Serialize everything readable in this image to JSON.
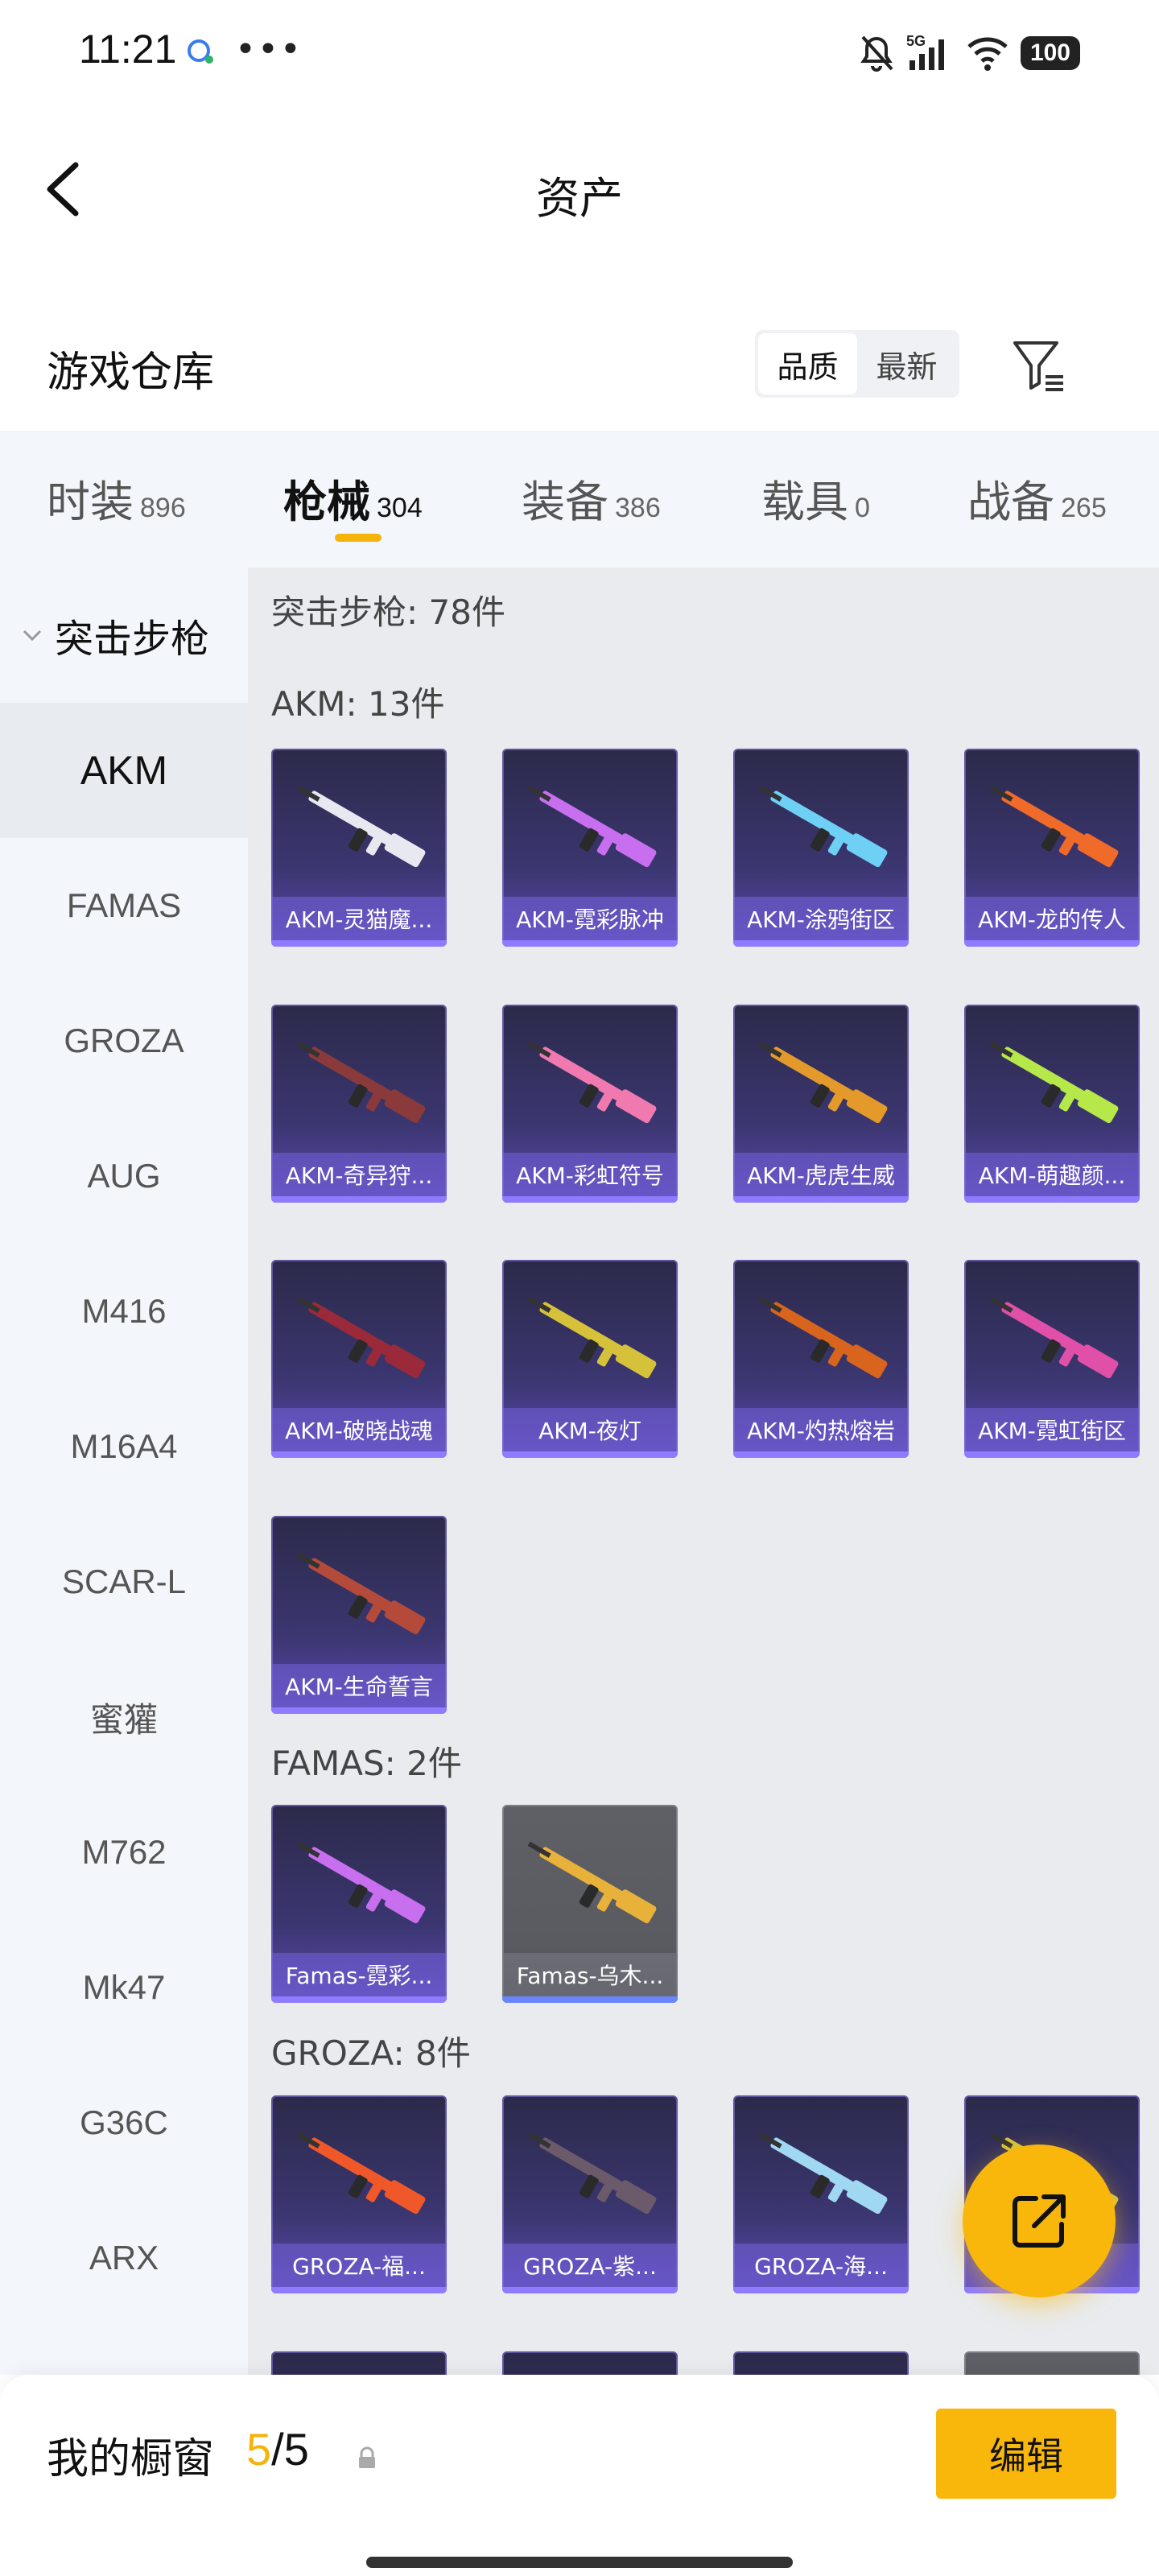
{
  "status_bar": {
    "time": "11:21",
    "dots": "•••",
    "network": "5G",
    "battery": "100"
  },
  "nav": {
    "title": "资产"
  },
  "header": {
    "title": "游戏仓库",
    "sort_options": [
      "品质",
      "最新"
    ],
    "active_sort": "品质"
  },
  "tabs": [
    {
      "label": "时装",
      "count": "896"
    },
    {
      "label": "枪械",
      "count": "304"
    },
    {
      "label": "装备",
      "count": "386"
    },
    {
      "label": "载具",
      "count": "0"
    },
    {
      "label": "战备",
      "count": "265"
    }
  ],
  "active_tab": "枪械",
  "sidebar": {
    "category": "突击步枪",
    "items": [
      "AKM",
      "FAMAS",
      "GROZA",
      "AUG",
      "M416",
      "M16A4",
      "SCAR-L",
      "蜜獾",
      "M762",
      "Mk47",
      "G36C",
      "ARX"
    ],
    "active": "AKM"
  },
  "content": {
    "summary": "突击步枪: 78件",
    "groups": [
      {
        "title": "AKM: 13件",
        "items": [
          "AKM-灵猫魔...",
          "AKM-霓彩脉冲",
          "AKM-涂鸦街区",
          "AKM-龙的传人",
          "AKM-奇异狩...",
          "AKM-彩虹符号",
          "AKM-虎虎生威",
          "AKM-萌趣颜...",
          "AKM-破晓战魂",
          "AKM-夜灯",
          "AKM-灼热熔岩",
          "AKM-霓虹街区",
          "AKM-生命誓言"
        ]
      },
      {
        "title": "FAMAS: 2件",
        "items": [
          "Famas-霓彩...",
          "Famas-乌木..."
        ]
      },
      {
        "title": "GROZA: 8件",
        "items": [
          "GROZA-福...",
          "GROZA-紫...",
          "GROZA-海...",
          "..."
        ]
      }
    ]
  },
  "bottom_bar": {
    "label": "我的橱窗",
    "count_current": "5",
    "count_sep": "/",
    "count_total": "5",
    "edit_label": "编辑"
  },
  "colors": {
    "accent": "#f9b70b",
    "card_purple": "#3b3670",
    "card_gray": "#5a5b61"
  },
  "icons": [
    "chat-bubble-icon",
    "mute-bell-icon",
    "signal-icon",
    "wifi-icon",
    "back-arrow-icon",
    "filter-icon",
    "chevron-down-icon",
    "lock-icon",
    "share-out-icon"
  ]
}
